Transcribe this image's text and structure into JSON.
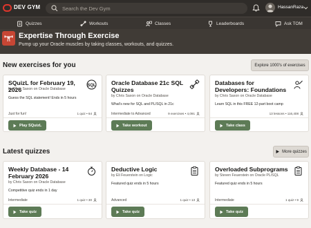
{
  "topbar": {
    "brand": "DEV GYM",
    "search_placeholder": "Search the Dev Gym",
    "username": "HassanRaza"
  },
  "nav": {
    "items": [
      {
        "label": "Quizzes",
        "icon": "quiz-icon"
      },
      {
        "label": "Workouts",
        "icon": "workout-icon"
      },
      {
        "label": "Classes",
        "icon": "class-icon"
      },
      {
        "label": "Leaderboards",
        "icon": "trophy-icon"
      },
      {
        "label": "Ask TOM",
        "icon": "chat-icon"
      }
    ]
  },
  "hero": {
    "title": "Expertise Through Exercise",
    "subtitle": "Pump up your Oracle muscles by taking classes, workouts, and quizzes."
  },
  "new_exercises": {
    "title": "New exercises for you",
    "explore_label": "Explore 1000's of exercises",
    "cards": [
      {
        "title": "SQuizL for February 19, 2026",
        "byline": "by Chris Saxon on Oracle Database",
        "desc": "Guess the SQL statement! Ends in 5 hours",
        "level": "Just for fun!",
        "stats": "1 quiz • 64",
        "button": "Play SQuizL",
        "icon": "squizl-icon"
      },
      {
        "title": "Oracle Database 21c SQL Quizzes",
        "byline": "by Chris Saxon on Oracle Database",
        "desc": "What's new for SQL and PL/SQL in 21c",
        "level": "Intermediate to Advanced",
        "stats": "9 exercises • 4,091",
        "button": "Take workout",
        "icon": "dumbbell-icon"
      },
      {
        "title": "Databases for Developers: Foundations",
        "byline": "by Chris Saxon on Oracle Database",
        "desc": "Learn SQL in this FREE 12-part boot camp",
        "level": "",
        "stats": "13 lessons • 116,408",
        "button": "Take class",
        "icon": "teacher-icon"
      }
    ]
  },
  "latest_quizzes": {
    "title": "Latest quizzes",
    "more_label": "More quizzes",
    "cards": [
      {
        "title": "Weekly Database - 14 February 2026",
        "byline": "by Chris Saxon on Oracle Database",
        "desc": "Competitive quiz ends in 1 day",
        "level": "Intermediate",
        "stats": "1 quiz • 30",
        "button": "Take quiz",
        "icon": "stopwatch-icon"
      },
      {
        "title": "Deductive Logic",
        "byline": "by Eli Feuerstein on Logic",
        "desc": "Featured quiz ends in 5 hours",
        "level": "Advanced",
        "stats": "1 quiz • 13",
        "button": "Take quiz",
        "icon": "clipboard-icon"
      },
      {
        "title": "Overloaded Subprograms",
        "byline": "by Steven Feuerstein on Oracle PL/SQL",
        "desc": "Featured quiz ends in 5 hours",
        "level": "Intermediate",
        "stats": "1 quiz • 9",
        "button": "Take quiz",
        "icon": "clipboard-icon"
      }
    ]
  },
  "colors": {
    "topbar": "#2f2c29",
    "hero": "#403b36",
    "accent_red": "#c74634",
    "button_green": "#5d7b56"
  }
}
